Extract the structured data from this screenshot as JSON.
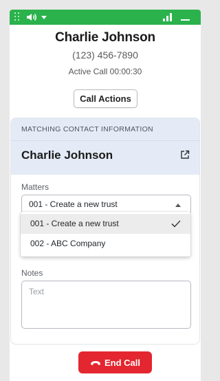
{
  "colors": {
    "topbar": "#2bb24c",
    "card_header": "#e4ebf6",
    "end_call": "#e3262f"
  },
  "topbar": {
    "icons": [
      "grip-icon",
      "speaker-icon",
      "chevron-down-icon",
      "signal-icon",
      "minimize-icon"
    ]
  },
  "caller": {
    "name": "Charlie Johnson",
    "phone": "(123) 456-7890",
    "status": "Active Call 00:00:30"
  },
  "call_actions_label": "Call Actions",
  "contact_section": {
    "title": "MATCHING CONTACT INFORMATION",
    "name": "Charlie Johnson",
    "open_icon": "external-link-icon"
  },
  "matters": {
    "label": "Matters",
    "selected": "001 - Create a new trust",
    "options": [
      {
        "label": "001 - Create a new trust",
        "selected": true
      },
      {
        "label": "002 - ABC Company",
        "selected": false
      }
    ]
  },
  "notes": {
    "label": "Notes",
    "placeholder": "Text"
  },
  "end_call_label": "End Call"
}
